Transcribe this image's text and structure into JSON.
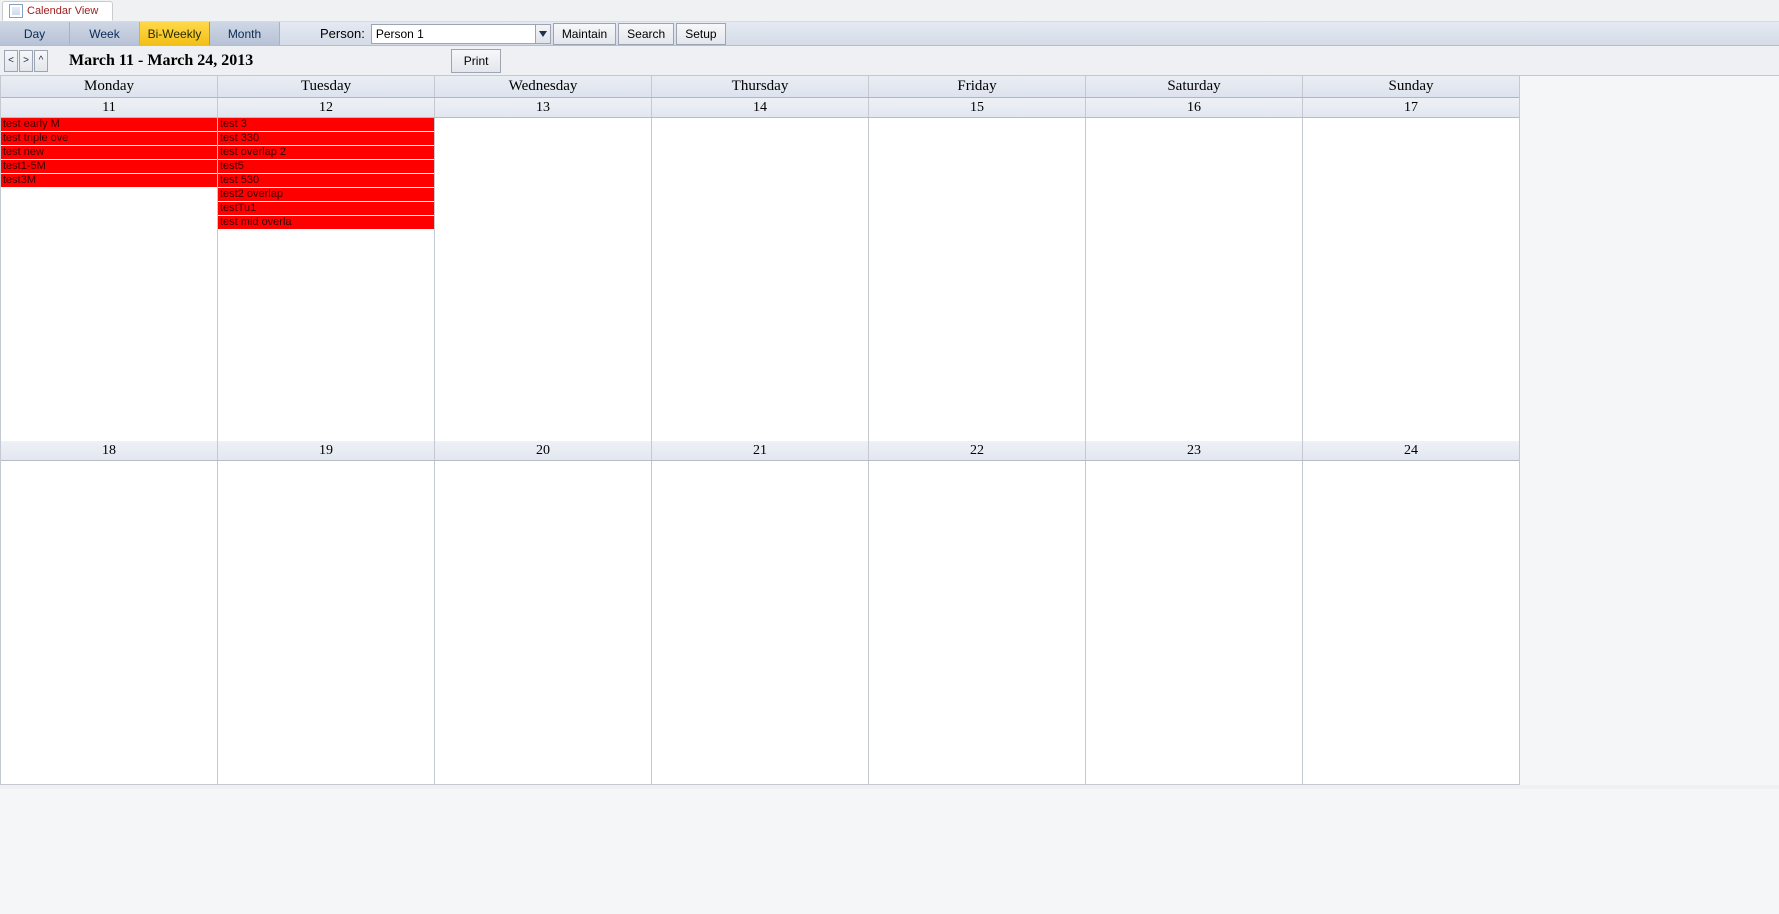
{
  "tab": {
    "title": "Calendar View"
  },
  "views": {
    "items": [
      {
        "label": "Day",
        "active": false
      },
      {
        "label": "Week",
        "active": false
      },
      {
        "label": "Bi-Weekly",
        "active": true
      },
      {
        "label": "Month",
        "active": false
      }
    ]
  },
  "person": {
    "label": "Person:",
    "value": "Person 1"
  },
  "toolbar_buttons": {
    "maintain": "Maintain",
    "search": "Search",
    "setup": "Setup"
  },
  "nav": {
    "prev": "<",
    "next": ">",
    "up": "^"
  },
  "date_range": "March 11 - March 24, 2013",
  "print_label": "Print",
  "day_headers": [
    "Monday",
    "Tuesday",
    "Wednesday",
    "Thursday",
    "Friday",
    "Saturday",
    "Sunday"
  ],
  "weeks": [
    {
      "dates": [
        "11",
        "12",
        "13",
        "14",
        "15",
        "16",
        "17"
      ],
      "events": [
        [
          "test early M",
          "test triple ove",
          "test new",
          "test1-5M",
          "test3M"
        ],
        [
          "test 3",
          "test 330",
          "test overlap 2",
          "test5",
          "test 530",
          "test2 overlap",
          "testTu1",
          "test mid overla"
        ],
        [],
        [],
        [],
        [],
        []
      ]
    },
    {
      "dates": [
        "18",
        "19",
        "20",
        "21",
        "22",
        "23",
        "24"
      ],
      "events": [
        [],
        [],
        [],
        [],
        [],
        [],
        []
      ]
    }
  ]
}
